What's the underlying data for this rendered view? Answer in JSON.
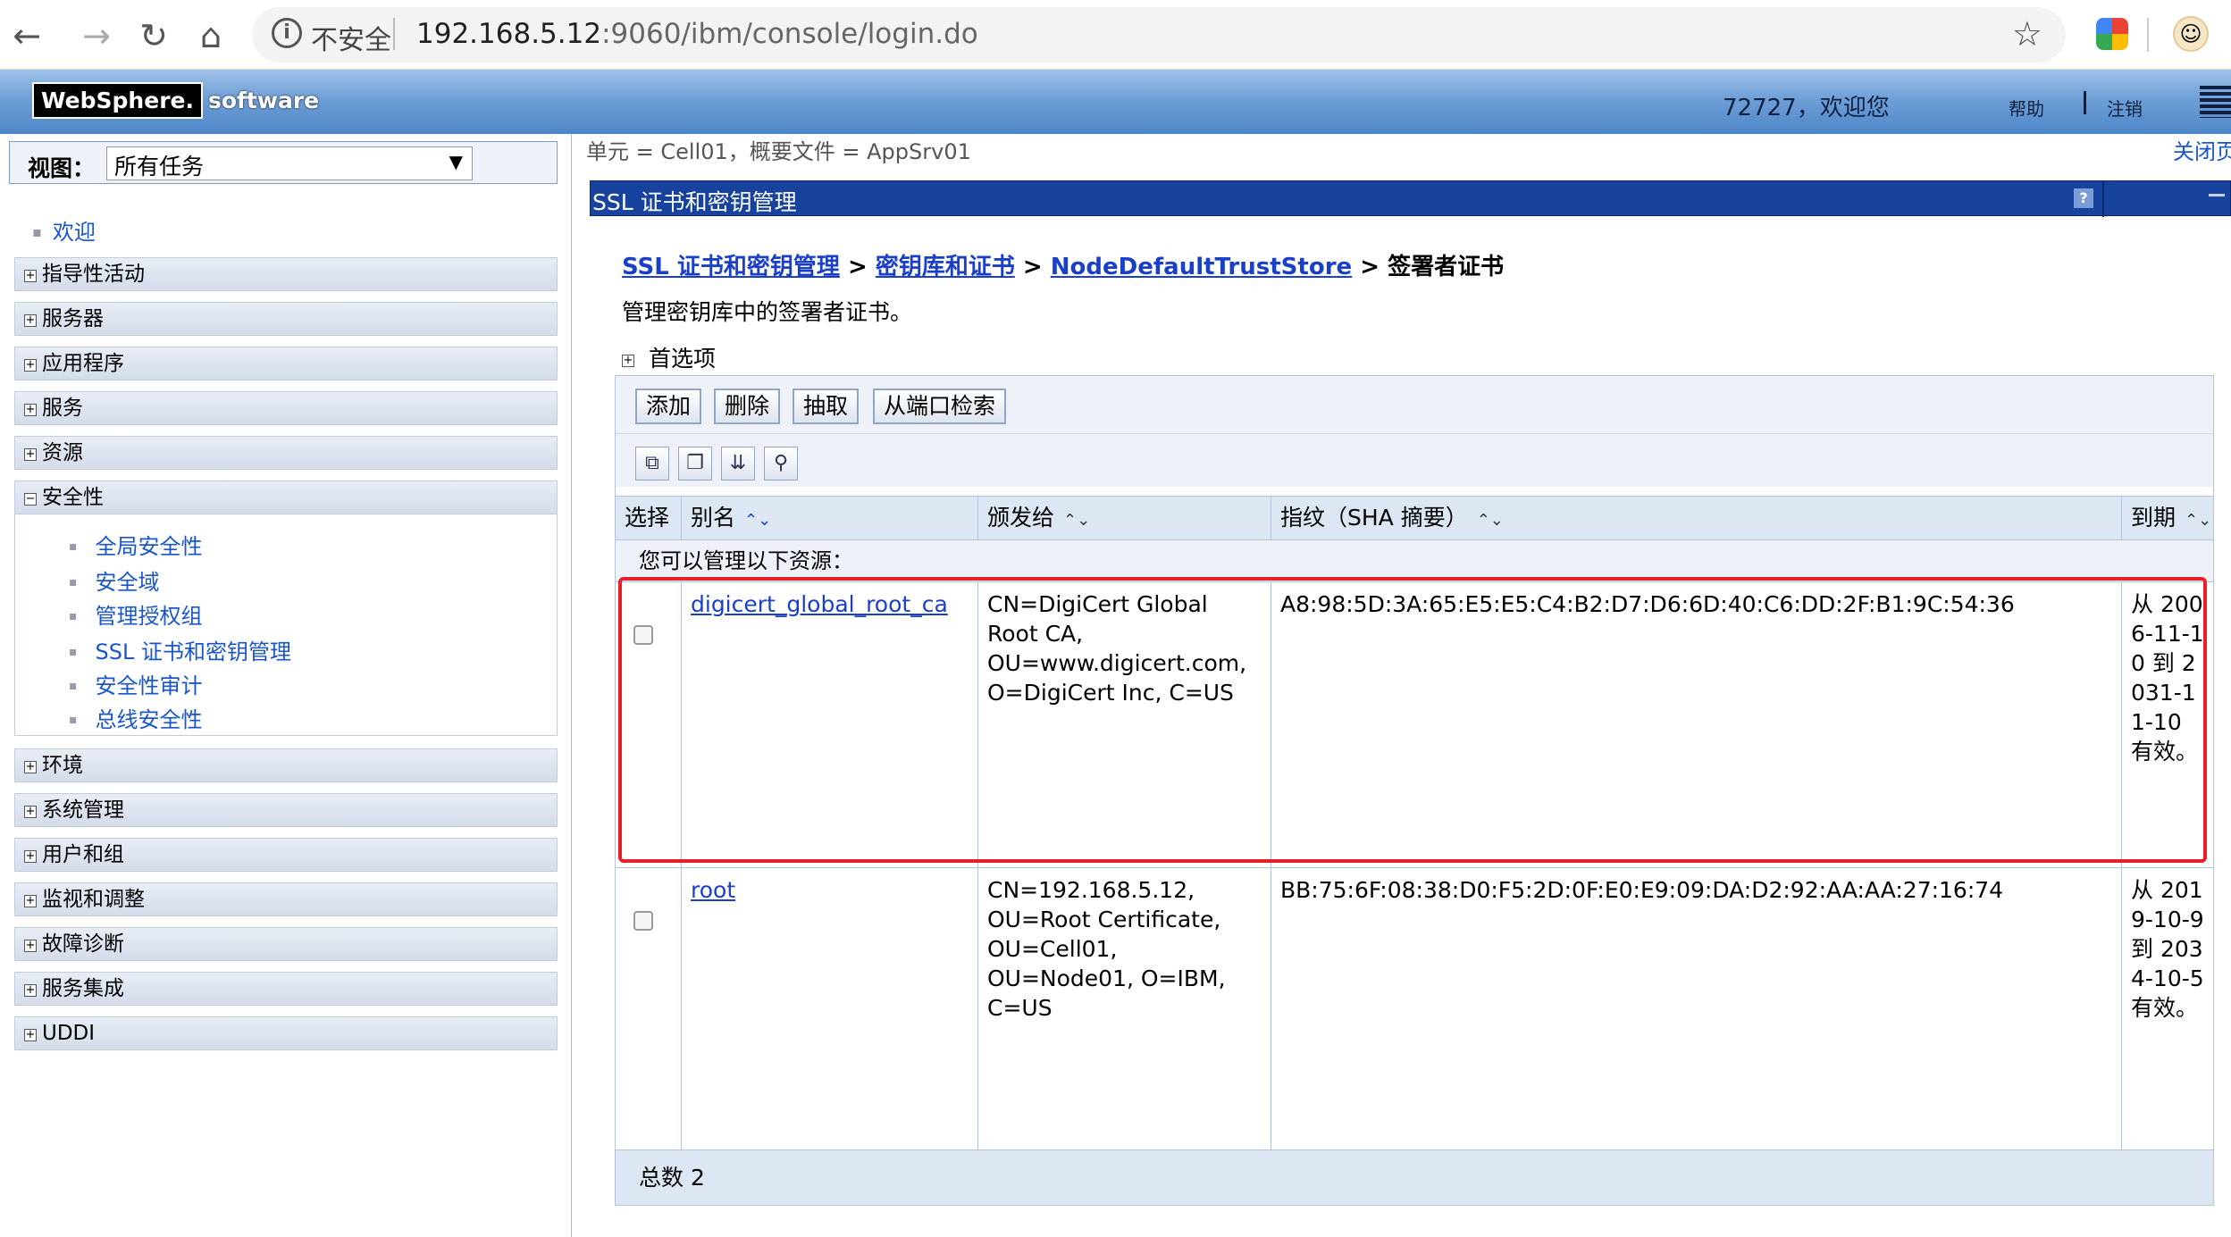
{
  "browser": {
    "insecure_label": "不安全",
    "url_host": "192.168.5.12",
    "url_rest": ":9060/ibm/console/login.do"
  },
  "header": {
    "logo_websphere": "WebSphere.",
    "logo_software": "software",
    "welcome": "72727，欢迎您",
    "help": "帮助",
    "logout": "注销"
  },
  "leftnav": {
    "view_label": "视图：",
    "view_value": "所有任务",
    "welcome": "欢迎",
    "items": [
      {
        "label": "指导性活动",
        "expanded": false
      },
      {
        "label": "服务器",
        "expanded": false
      },
      {
        "label": "应用程序",
        "expanded": false
      },
      {
        "label": "服务",
        "expanded": false
      },
      {
        "label": "资源",
        "expanded": false
      },
      {
        "label": "安全性",
        "expanded": true
      },
      {
        "label": "环境",
        "expanded": false
      },
      {
        "label": "系统管理",
        "expanded": false
      },
      {
        "label": "用户和组",
        "expanded": false
      },
      {
        "label": "监视和调整",
        "expanded": false
      },
      {
        "label": "故障诊断",
        "expanded": false
      },
      {
        "label": "服务集成",
        "expanded": false
      },
      {
        "label": "UDDI",
        "expanded": false
      }
    ],
    "security_children": [
      "全局安全性",
      "安全域",
      "管理授权组",
      "SSL 证书和密钥管理",
      "安全性审计",
      "总线安全性"
    ]
  },
  "main": {
    "scope": "单元 = Cell01，概要文件 = AppSrv01",
    "close_page": "关闭页",
    "panel_title": "SSL 证书和密钥管理",
    "help_q": "?",
    "crumbs": {
      "link1": "SSL 证书和密钥管理",
      "link2": "密钥库和证书",
      "link3": "NodeDefaultTrustStore",
      "current": "签署者证书",
      "sep": ">"
    },
    "description": "管理密钥库中的签署者证书。",
    "preferences": "首选项",
    "buttons": {
      "add": "添加",
      "delete": "删除",
      "extract": "抽取",
      "retrieve": "从端口检索"
    },
    "columns": {
      "select": "选择",
      "alias": "别名",
      "issued_to": "颁发给",
      "fingerprint": "指纹（SHA 摘要）",
      "expiry": "到期"
    },
    "resources_label": "您可以管理以下资源：",
    "rows": [
      {
        "alias": "digicert_global_root_ca",
        "issued_to": "CN=DigiCert Global Root CA, OU=www.digicert.com, O=DigiCert Inc, C=US",
        "fingerprint": "A8:98:5D:3A:65:E5:E5:C4:B2:D7:D6:6D:40:C6:DD:2F:B1:9C:54:36",
        "expiry": "从 2006-11-10 到 2031-11-10 有效。"
      },
      {
        "alias": "root",
        "issued_to": "CN=192.168.5.12, OU=Root Certificate, OU=Cell01, OU=Node01, O=IBM, C=US",
        "fingerprint": "BB:75:6F:08:38:D0:F5:2D:0F:E0:E9:09:DA:D2:92:AA:AA:27:16:74",
        "expiry": "从 2019-10-9 到 2034-10-5 有效。"
      }
    ],
    "total": "总数 2"
  },
  "colors": {
    "link": "#1a3fc8",
    "panel_title_bg": "#17429e",
    "highlight_border": "#e8202a"
  }
}
